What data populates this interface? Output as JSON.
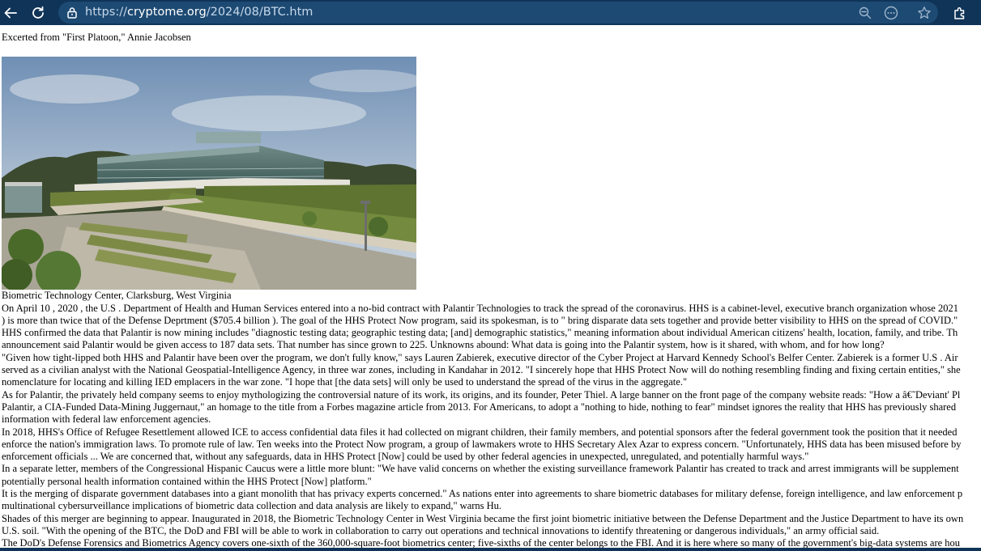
{
  "browser": {
    "url_scheme": "https://",
    "url_host": "cryptome.org",
    "url_path": "/2024/08/BTC.htm"
  },
  "page": {
    "intro": "Excerted from \"First Platoon,\" Annie Jacobsen",
    "photo_alt": "Biometric Technology Center photograph",
    "caption": "Biometric Technology Center, Clarksburg, West Virginia",
    "lines": [
      "On April 10 , 2020 , the U.S . Department of Health and Human Services entered into a no-bid contract with Palantir Technologies to track the spread of the coronavirus. HHS is a cabinet-level, executive branch organization whose 2021",
      ") is more than twice that of the Defense Deprtment ($705.4 billion ). The goal of the HHS Protect Now program, said its spokesman, is to \" bring disparate data sets together and provide better visibility to HHS on the spread of COVID.\"",
      "HHS confirmed the data that Palantir is now mining includes \"diagnostic testing data; geographic testing data; [and] demographic statistics,\" meaning information about individual American citizens' health, location, family, and tribe. Th",
      "announcement said Palantir would be given access to 187 data sets. That number has since grown to 225. Unknowns abound: What data is going into the Palantir system, how is it shared, with whom, and for how long?",
      "\"Given how tight-lipped both HHS and Palantir have been over the program, we don't fully know,\" says Lauren Zabierek, executive director of the Cyber Project at Harvard Kennedy School's Belfer Center. Zabierek is a former U.S . Air",
      "served as a civilian analyst with the National Geospatial-Intelligence Agency, in three war zones, including in Kandahar in 2012. \"I sincerely hope that HHS Protect Now will do nothing resembling finding and fixing certain entities,\" she",
      "nomenclature for locating and killing IED emplacers in the war zone. \"I hope that [the data sets] will only be used to understand the spread of the virus in the aggregate.\"",
      "As for Palantir, the privately held company seems to enjoy mythologizing the controversial nature of its work, its origins, and its founder, Peter Thiel. A large banner on the front page of the company website reads: \"How a â€˜Deviant' Pl",
      "Palantir, a CIA-Funded Data-Mining Juggernaut,\" an homage to the title from a Forbes magazine article from 2013. For Americans, to adopt a \"nothing to hide, nothing to fear\" mindset ignores the reality that HHS has previously shared",
      "information with federal law enforcement agencies.",
      "In 2018, HHS's Office of Refugee Resettlement allowed ICE to access confidential data files it had collected on migrant children, their family members, and potential sponsors after the federal government took the position that it needed",
      "enforce the nation's immigration laws. To promote rule of law. Ten weeks into the Protect Now program, a group of lawmakers wrote to HHS Secretary Alex Azar to express concern. \"Unfortunately, HHS data has been misused before by",
      "enforcement officials ... We are concerned that, without any safeguards, data in HHS Protect [Now] could be used by other federal agencies in unexpected, unregulated, and potentially harmful ways.\"",
      "In a separate letter, members of the Congressional Hispanic Caucus were a little more blunt: \"We have valid concerns on whether the existing surveillance framework Palantir has created to track and arrest immigrants will be supplement",
      "potentially personal health information contained within the HHS Protect [Now] platform.\"",
      "It is the merging of disparate government databases into a giant monolith that has privacy experts concerned.\" As nations enter into agreements to share biometric databases for military defense, foreign intelligence, and law enforcement p",
      "multinational cybersurveillance implications of biometric data collection and data analysis are likely to expand,\" warns Hu.",
      "Shades of this merger are beginning to appear. Inaugurated in 2018, the Biometric Technology Center in West Virginia became the first joint biometric initiative between the Defense Department and the Justice Department to have its own",
      "U.S. soil. \"With the opening of the BTC, the DoD and FBI will be able to work in collaboration to carry out operations and technical innovations to identify threatening or dangerous individuals,\" an army official said.",
      "The DoD's Defense Forensics and Biometrics Agency covers one-sixth of the 360,000-square-foot biometrics center; five-sixths of the center belongs to the FBI. And it is here where so many of the government's big-data systems are hou"
    ]
  }
}
